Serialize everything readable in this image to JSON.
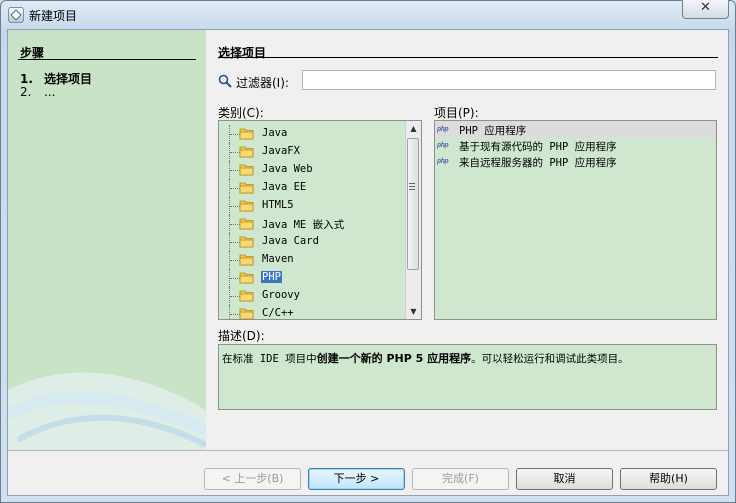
{
  "window": {
    "title": "新建项目",
    "close_glyph": "✕"
  },
  "steps": {
    "header": "步骤",
    "items": [
      {
        "num": "1.",
        "label": "选择项目"
      },
      {
        "num": "2.",
        "label": "..."
      }
    ]
  },
  "main": {
    "title": "选择项目",
    "filter_label": "过滤器(I):",
    "filter_value": "",
    "categories_label": "类别(C):",
    "projects_label": "项目(P):",
    "description_label": "描述(D):"
  },
  "categories": [
    "Java",
    "JavaFX",
    "Java Web",
    "Java EE",
    "HTML5",
    "Java ME 嵌入式",
    "Java Card",
    "Maven",
    "PHP",
    "Groovy",
    "C/C++"
  ],
  "selected_category": "PHP",
  "projects": [
    "PHP 应用程序",
    "基于现有源代码的 PHP 应用程序",
    "来自远程服务器的 PHP 应用程序"
  ],
  "selected_project": "PHP 应用程序",
  "icon_text": "php",
  "description": {
    "pre": "在标准 IDE 项目中",
    "bold": "创建一个新的 PHP 5 应用程序",
    "post": "。可以轻松运行和调试此类项目。"
  },
  "buttons": {
    "back": "< 上一步(B)",
    "next": "下一步 >",
    "finish": "完成(F)",
    "cancel": "取消",
    "help": "帮助(H)"
  },
  "colors": {
    "panel_green": "#c9e3c6",
    "list_green": "#cfe6cf",
    "selection_blue": "#3a78c4"
  }
}
